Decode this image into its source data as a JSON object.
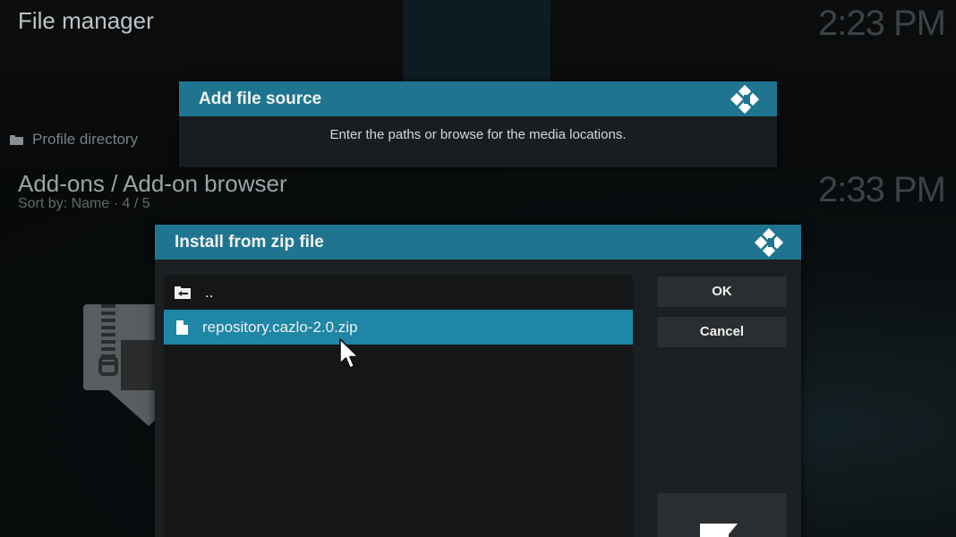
{
  "top_screen": {
    "title": "File manager",
    "clock": "2:23 PM",
    "profile_directory": "Profile directory",
    "dialog": {
      "title": "Add file source",
      "message": "Enter the paths or browse for the media locations."
    }
  },
  "bottom_screen": {
    "title": "Add-ons / Add-on browser",
    "sort_info": "Sort by: Name  ·  4 / 5",
    "clock": "2:33 PM",
    "dialog": {
      "title": "Install from zip file",
      "items": [
        {
          "label": "..",
          "icon": "parent-folder-icon",
          "selected": false
        },
        {
          "label": "repository.cazlo-2.0.zip",
          "icon": "file-icon",
          "selected": true
        }
      ],
      "buttons": {
        "ok": "OK",
        "cancel": "Cancel"
      }
    }
  },
  "colors": {
    "header_blue": "#1f7590",
    "selection_blue": "#1f86a6",
    "dialog_bg": "#1c1f21",
    "button_bg": "#2a2e30"
  }
}
